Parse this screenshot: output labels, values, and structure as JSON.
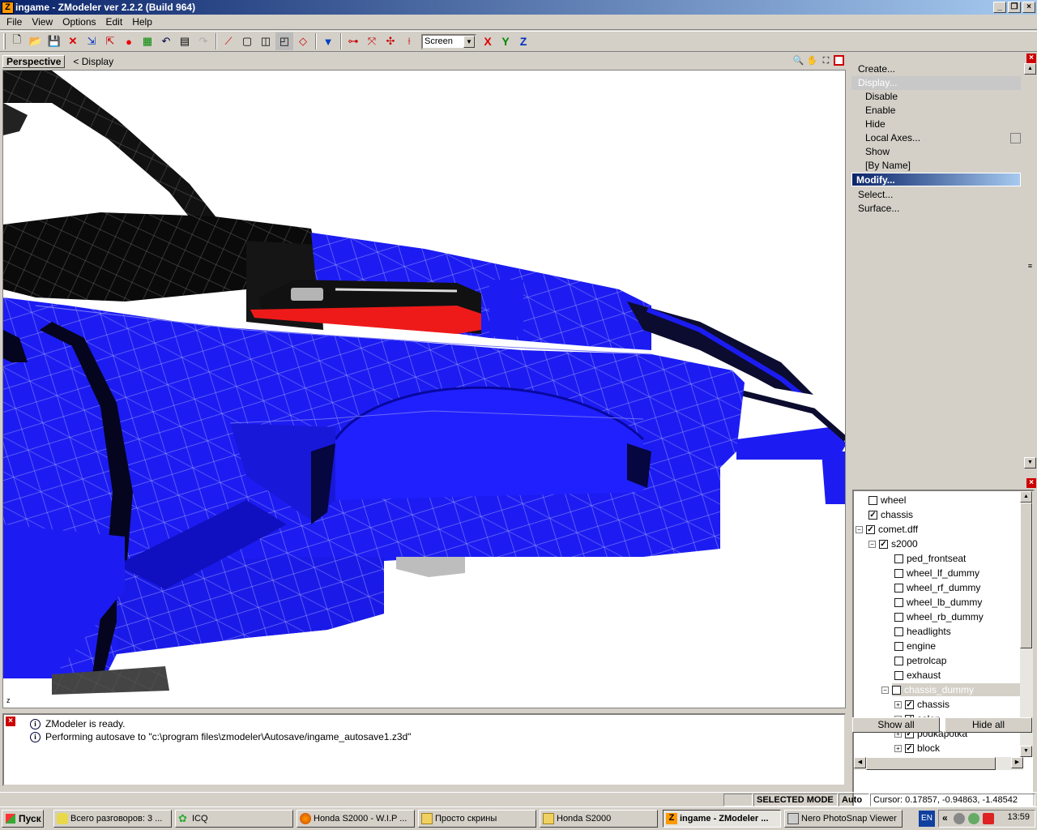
{
  "window": {
    "title": "ingame - ZModeler ver 2.2.2 (Build 964)"
  },
  "menu": [
    "File",
    "View",
    "Options",
    "Edit",
    "Help"
  ],
  "toolbar": {
    "coord_select": "Screen",
    "axis_x": "X",
    "axis_y": "Y",
    "axis_z": "Z"
  },
  "viewport": {
    "name": "Perspective",
    "display": "<  Display",
    "axis_indicator": "z"
  },
  "log": [
    "ZModeler is ready.",
    "Performing autosave to \"c:\\program files\\zmodeler\\Autosave/ingame_autosave1.z3d\""
  ],
  "commands": {
    "create": "Create...",
    "display": "Display...",
    "disable": "Disable",
    "enable": "Enable",
    "hide": "Hide",
    "local_axes": "Local Axes...",
    "show": "Show",
    "by_name": "[By Name]",
    "modify": "Modify...",
    "select": "Select...",
    "surface": "Surface..."
  },
  "tree": [
    {
      "label": "wheel",
      "checked": false,
      "expander": "",
      "level": 0
    },
    {
      "label": "chassis",
      "checked": true,
      "expander": "",
      "level": 0
    },
    {
      "label": "comet.dff",
      "checked": true,
      "expander": "−",
      "level": 0
    },
    {
      "label": "s2000",
      "checked": true,
      "expander": "−",
      "level": 1
    },
    {
      "label": "ped_frontseat",
      "checked": false,
      "expander": "",
      "level": 2
    },
    {
      "label": "wheel_lf_dummy",
      "checked": false,
      "expander": "",
      "level": 2
    },
    {
      "label": "wheel_rf_dummy",
      "checked": false,
      "expander": "",
      "level": 2
    },
    {
      "label": "wheel_lb_dummy",
      "checked": false,
      "expander": "",
      "level": 2
    },
    {
      "label": "wheel_rb_dummy",
      "checked": false,
      "expander": "",
      "level": 2
    },
    {
      "label": "headlights",
      "checked": false,
      "expander": "",
      "level": 2
    },
    {
      "label": "engine",
      "checked": false,
      "expander": "",
      "level": 2
    },
    {
      "label": "petrolcap",
      "checked": false,
      "expander": "",
      "level": 2
    },
    {
      "label": "exhaust",
      "checked": false,
      "expander": "",
      "level": 2
    },
    {
      "label": "chassis_dummy",
      "checked": true,
      "expander": "−",
      "level": 2,
      "highlighted": true
    },
    {
      "label": "chassis",
      "checked": true,
      "expander": "+",
      "level": 3
    },
    {
      "label": "salon",
      "checked": true,
      "expander": "+",
      "level": 3
    },
    {
      "label": "podkapotka",
      "checked": true,
      "expander": "+",
      "level": 3
    },
    {
      "label": "block",
      "checked": true,
      "expander": "+",
      "level": 3
    }
  ],
  "buttons": {
    "show_all": "Show all",
    "hide_all": "Hide all"
  },
  "status": {
    "mode": "SELECTED MODE",
    "auto": "Auto",
    "cursor": "Cursor: 0.17857, -0.94863, -1.48542"
  },
  "taskbar": {
    "start": "Пуск",
    "tasks": [
      "Всего разговоров: 3 ...",
      "ICQ",
      "Honda S2000 - W.I.P ...",
      "Просто скрины",
      "Honda S2000",
      "ingame - ZModeler ...",
      "Nero PhotoSnap Viewer"
    ],
    "lang": "EN",
    "clock": "13:59"
  },
  "colors": {
    "body_blue": "#1c1cf2",
    "engine_red": "#ee1a1a",
    "title_gradient_start": "#0a246a",
    "title_gradient_end": "#a6caf0"
  }
}
